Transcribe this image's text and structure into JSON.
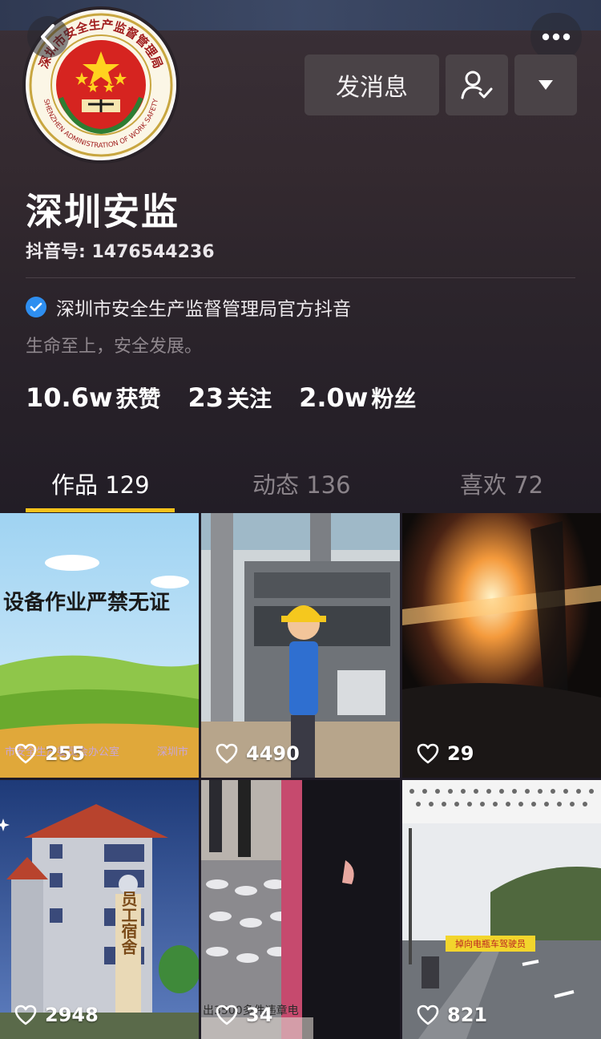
{
  "profile": {
    "seal_text": "深圳市安全生产监督管理局",
    "seal_text_en": "SHENZHEN ADMINISTRATION OF WORK SAFETY",
    "name": "深圳安监",
    "douyin_id": "抖音号: 1476544236",
    "verified_label": "深圳市安全生产监督管理局官方抖音",
    "bio": "生命至上，安全发展。"
  },
  "actions": {
    "message_label": "发消息",
    "follow_icon": "user-check-icon",
    "dropdown_icon": "triangle-down-icon",
    "back_icon": "chevron-left-icon",
    "more_icon": "more-dots-icon"
  },
  "stats": [
    {
      "num": "10.6w",
      "label": "获赞"
    },
    {
      "num": "23",
      "label": "关注"
    },
    {
      "num": "2.0w",
      "label": "粉丝"
    }
  ],
  "tabs": [
    {
      "label": "作品 129",
      "active": true
    },
    {
      "label": "动态 136",
      "active": false
    },
    {
      "label": "喜欢 72",
      "active": false
    }
  ],
  "videos": [
    {
      "likes": "255",
      "caption": "设备作业严禁无证",
      "footer": "市安全生产委员会办公室",
      "footer2": "深圳市"
    },
    {
      "likes": "4490"
    },
    {
      "likes": "29"
    },
    {
      "likes": "2948",
      "caption": "员工宿舍"
    },
    {
      "likes": "34",
      "caption": "出3500多件违章电"
    },
    {
      "likes": "821",
      "caption": "掉向电瓶车驾驶员"
    }
  ],
  "colors": {
    "accent": "#f5c21b",
    "verified": "#2e8ef0",
    "background": "#221d26"
  }
}
